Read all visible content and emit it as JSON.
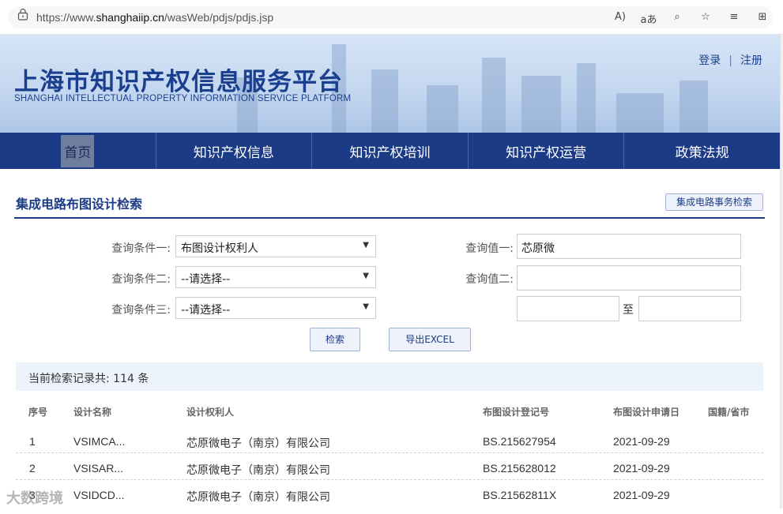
{
  "browser": {
    "url_prefix": "https://www.",
    "url_domain": "shanghaiip.cn",
    "url_path": "/wasWeb/pdjs/pdjs.jsp",
    "icons": [
      "read-aloud-icon",
      "translate-icon",
      "zoom-icon",
      "favorite-add-icon",
      "favorites-icon",
      "collections-icon"
    ],
    "icon_glyphs": [
      "A)",
      "aあ",
      "⌕",
      "☆",
      "≡",
      "⊞"
    ]
  },
  "header": {
    "title": "上海市知识产权信息服务平台",
    "subtitle": "SHANGHAI INTELLECTUAL PROPERTY INFORMATION SERVICE PLATFORM",
    "login": "登录",
    "separator": "|",
    "register": "注册"
  },
  "nav": {
    "items": [
      {
        "label": "首页",
        "active": true
      },
      {
        "label": "知识产权信息",
        "active": false
      },
      {
        "label": "知识产权培训",
        "active": false
      },
      {
        "label": "知识产权运营",
        "active": false
      },
      {
        "label": "政策法规",
        "active": false
      }
    ]
  },
  "section": {
    "title": "集成电路布图设计检索",
    "affairs_button": "集成电路事务检索"
  },
  "form": {
    "cond1_label": "查询条件一:",
    "cond1_value": "布图设计权利人",
    "cond2_label": "查询条件二:",
    "cond2_value": "--请选择--",
    "cond3_label": "查询条件三:",
    "cond3_value": "--请选择--",
    "val1_label": "查询值一:",
    "val1_value": "芯原微",
    "val2_label": "查询值二:",
    "val2_value": "",
    "range_from": "",
    "range_to_label": "至",
    "range_to": "",
    "search_button": "检索",
    "export_button": "导出EXCEL"
  },
  "results": {
    "summary_prefix": "当前检索记录共:",
    "count": "114",
    "summary_suffix": "条",
    "columns": [
      "序号",
      "设计名称",
      "设计权利人",
      "布图设计登记号",
      "布图设计申请日",
      "国籍/省市"
    ],
    "rows": [
      {
        "no": "1",
        "name": "VSIMCA...",
        "holder": "芯原微电子（南京）有限公司",
        "reg_no": "BS.215627954",
        "date": "2021-09-29",
        "region": ""
      },
      {
        "no": "2",
        "name": "VSISAR...",
        "holder": "芯原微电子（南京）有限公司",
        "reg_no": "BS.215628012",
        "date": "2021-09-29",
        "region": ""
      },
      {
        "no": "3",
        "name": "VSIDCD...",
        "holder": "芯原微电子（南京）有限公司",
        "reg_no": "BS.21562811X",
        "date": "2021-09-29",
        "region": ""
      }
    ]
  },
  "watermark": "大数跨境"
}
